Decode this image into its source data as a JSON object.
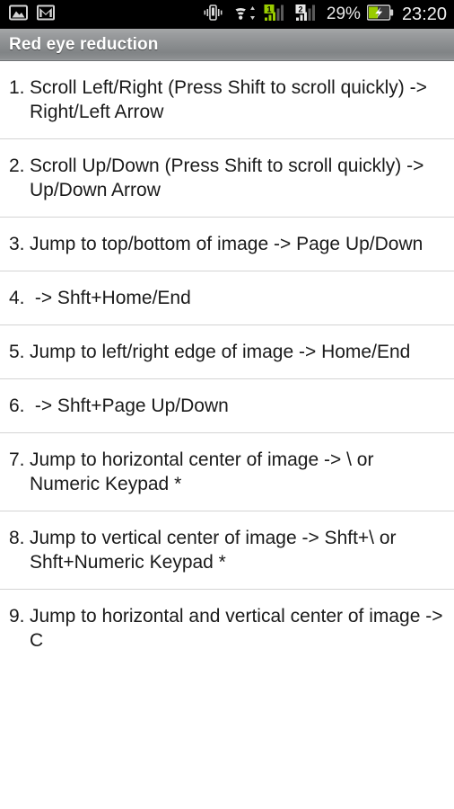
{
  "statusbar": {
    "left_icons": [
      {
        "name": "gallery-icon",
        "glyph": "image"
      },
      {
        "name": "gmail-icon",
        "glyph": "mail"
      }
    ],
    "right_icons": [
      {
        "name": "vibrate-icon",
        "glyph": "vibrate"
      },
      {
        "name": "wifi-icon",
        "glyph": "wifi"
      },
      {
        "name": "sim1-signal-icon",
        "glyph": "signal",
        "sim_label": "1"
      },
      {
        "name": "sim2-signal-icon",
        "glyph": "signal",
        "sim_label": "2"
      }
    ],
    "battery_percent": "29%",
    "battery_level": 29,
    "battery_charging": true,
    "clock": "23:20",
    "colors": {
      "background": "#000000",
      "text": "#e8e8e8",
      "signal_active": "#99cc00",
      "battery_fill": "#99cc00"
    }
  },
  "titlebar": {
    "title": "Red eye reduction",
    "colors": {
      "text": "#ffffff",
      "gradient_top": "#a6a8a9",
      "gradient_bottom": "#818486"
    }
  },
  "shortcuts": {
    "items": [
      {
        "num": "1.",
        "text": "Scroll Left/Right (Press Shift to scroll quickly) -> Right/Left Arrow"
      },
      {
        "num": "2.",
        "text": "Scroll Up/Down (Press Shift to scroll quickly) -> Up/Down Arrow"
      },
      {
        "num": "3.",
        "text": "Jump to top/bottom of image -> Page Up/Down"
      },
      {
        "num": "4.",
        "text": " -> Shft+Home/End"
      },
      {
        "num": "5.",
        "text": "Jump to left/right edge of image -> Home/End"
      },
      {
        "num": "6.",
        "text": " -> Shft+Page Up/Down"
      },
      {
        "num": "7.",
        "text": "Jump to horizontal center of image -> \\ or Numeric Keypad *"
      },
      {
        "num": "8.",
        "text": "Jump to vertical center of image -> Shft+\\ or Shft+Numeric Keypad *"
      },
      {
        "num": "9.",
        "text": "Jump to horizontal and vertical center of image -> C"
      }
    ],
    "colors": {
      "text": "#1a1a1a",
      "divider": "#d4d4d4",
      "background": "#ffffff"
    }
  }
}
